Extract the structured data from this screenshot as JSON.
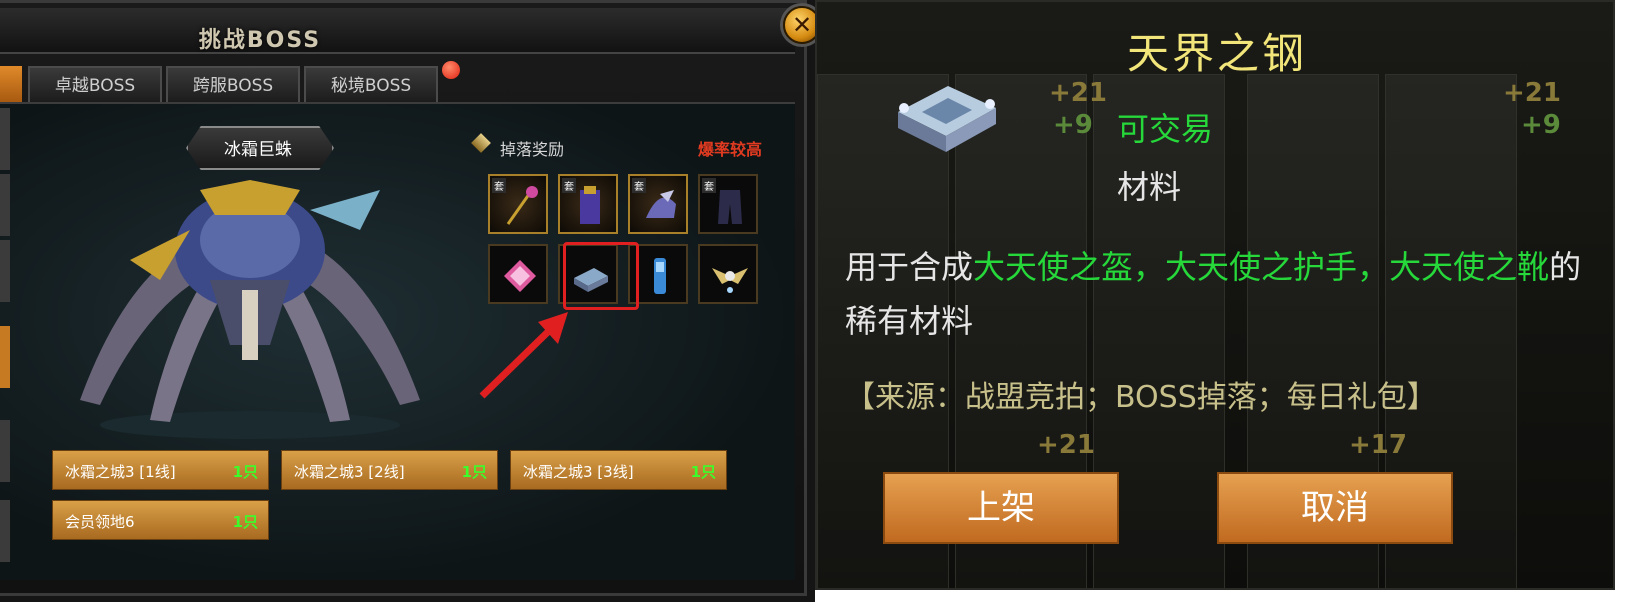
{
  "left_panel": {
    "title": "挑战BOSS",
    "close_glyph": "✕",
    "tabs": [
      {
        "label": "卓越BOSS"
      },
      {
        "label": "跨服BOSS"
      },
      {
        "label": "秘境BOSS"
      }
    ],
    "boss_name": "冰霜巨蛛",
    "drop_label": "掉落奖励",
    "rate_label": "爆率较高",
    "set_tag": "套",
    "locations": [
      {
        "name": "冰霜之城3 [1线]",
        "count": "1只"
      },
      {
        "name": "冰霜之城3 [2线]",
        "count": "1只"
      },
      {
        "name": "冰霜之城3 [3线]",
        "count": "1只"
      },
      {
        "name": "会员领地6",
        "count": "1只"
      }
    ]
  },
  "tooltip": {
    "item_name": "天界之钢",
    "tradeable": "可交易",
    "item_type": "材料",
    "desc_prefix": "用于合成",
    "desc_item1": "大天使之盔",
    "desc_sep1": "，",
    "desc_item2": "大天使之护手",
    "desc_sep2": "，",
    "desc_item3": "大天使之靴",
    "desc_suffix": "的稀有材料",
    "source": "【来源：战盟竞拍；BOSS掉落；每日礼包】",
    "list_button": "上架",
    "cancel_button": "取消",
    "bg_numbers": [
      "+21",
      "+9",
      "+21",
      "+9",
      "+21",
      "+17"
    ],
    "bg_tag": "套"
  },
  "colors": {
    "accent_orange": "#c67a22",
    "green_text": "#26d83a",
    "gold_title": "#f2e67a",
    "red_rate": "#e03a20"
  }
}
